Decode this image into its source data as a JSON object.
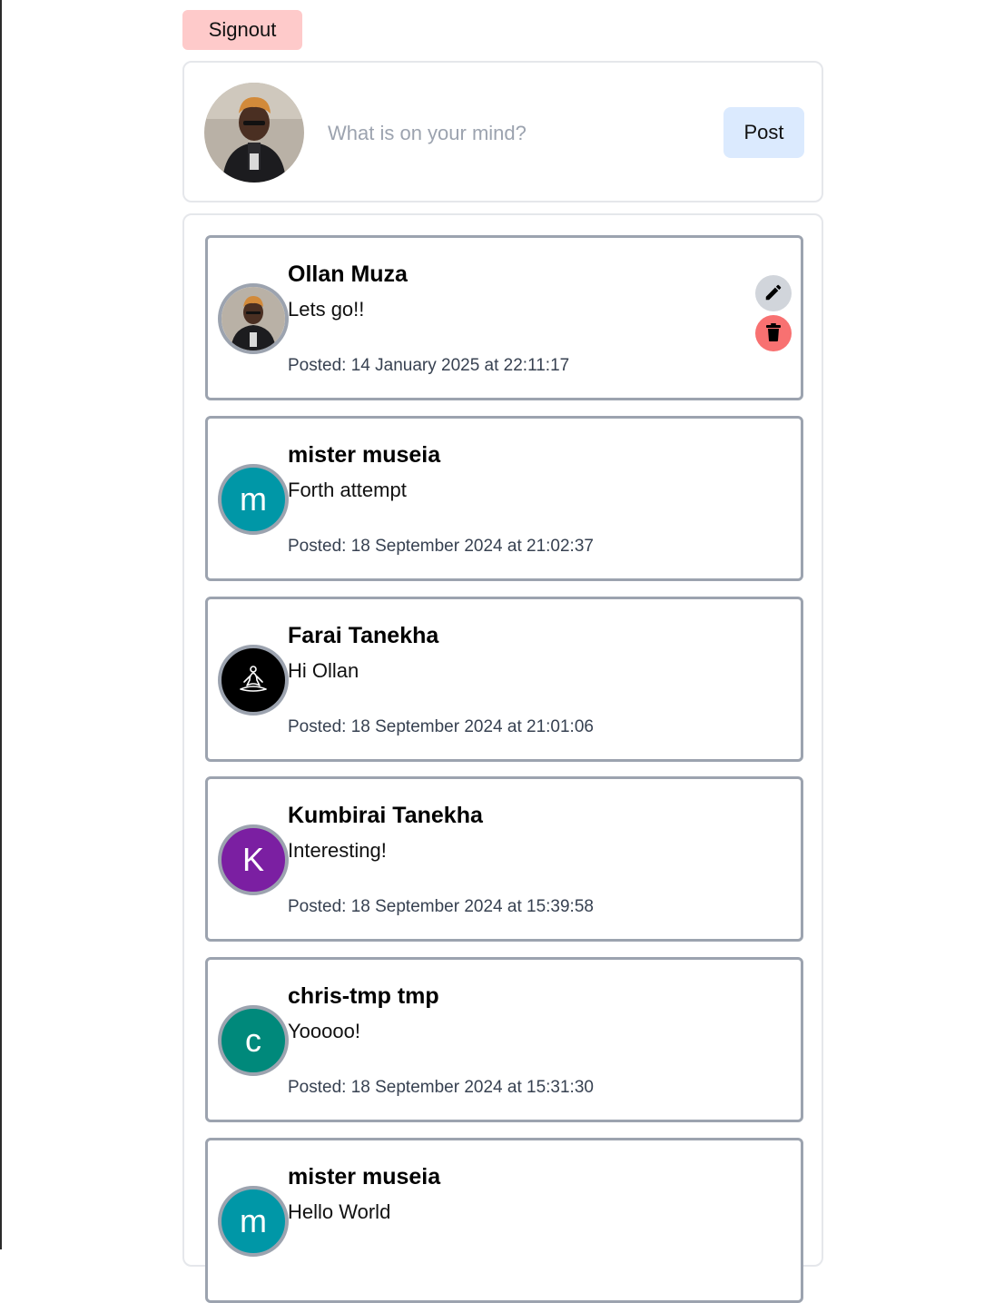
{
  "header": {
    "signout_label": "Signout"
  },
  "composer": {
    "placeholder": "What is on your mind?",
    "post_label": "Post",
    "avatar_icon": "user-photo-avatar"
  },
  "colors": {
    "signout_bg": "#fecaca",
    "post_bg": "#dbeafe",
    "edit_bg": "#d1d5db",
    "delete_bg": "#f87171",
    "card_border": "#9ca3af"
  },
  "posts": [
    {
      "author": "Ollan Muza",
      "body": "Lets go!!",
      "date": "Posted: 14 January 2025 at 22:11:17",
      "avatar_type": "photo",
      "avatar_icon": "user-photo-avatar",
      "actions": {
        "edit_icon": "pencil-icon",
        "delete_icon": "trash-icon"
      }
    },
    {
      "author": "mister museia",
      "body": "Forth attempt",
      "date": "Posted: 18 September 2024 at 21:02:37",
      "avatar_type": "letter",
      "avatar_letter": "m",
      "avatar_color": "#0097a7"
    },
    {
      "author": "Farai Tanekha",
      "body": "Hi Ollan",
      "date": "Posted: 18 September 2024 at 21:01:06",
      "avatar_type": "icon",
      "avatar_icon": "meditation-icon",
      "avatar_color": "#000000"
    },
    {
      "author": "Kumbirai Tanekha",
      "body": "Interesting!",
      "date": "Posted: 18 September 2024 at 15:39:58",
      "avatar_type": "letter",
      "avatar_letter": "K",
      "avatar_color": "#7b1fa2"
    },
    {
      "author": "chris-tmp tmp",
      "body": "Yooooo!",
      "date": "Posted: 18 September 2024 at 15:31:30",
      "avatar_type": "letter",
      "avatar_letter": "c",
      "avatar_color": "#00897b"
    },
    {
      "author": "mister museia",
      "body": "Hello World",
      "date": "",
      "avatar_type": "letter",
      "avatar_letter": "m",
      "avatar_color": "#0097a7"
    }
  ]
}
